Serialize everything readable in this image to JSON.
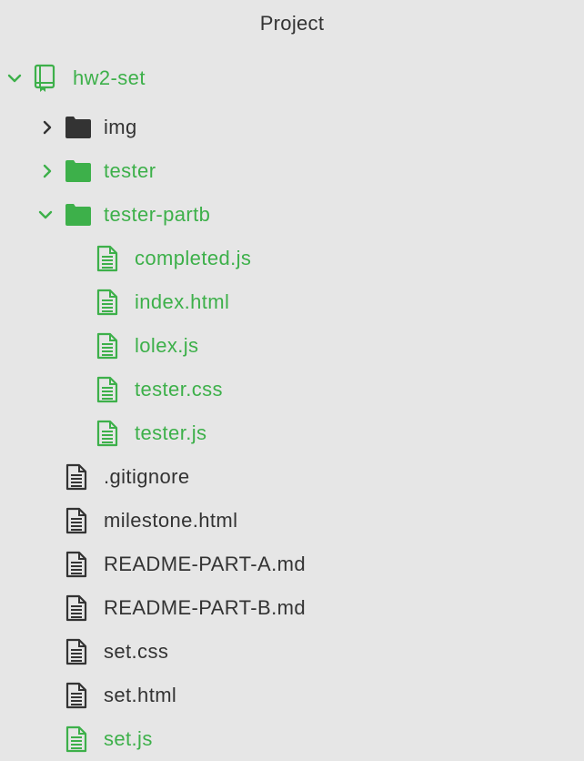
{
  "panel": {
    "title": "Project"
  },
  "colors": {
    "vcs_modified": "#3db04a",
    "default_text": "#333333",
    "background": "#e6e6e6"
  },
  "tree": {
    "root": {
      "label": "hw2-set",
      "icon": "repo-book-icon",
      "expanded": true,
      "status": "modified"
    },
    "items": [
      {
        "label": "img",
        "type": "folder",
        "expanded": false,
        "status": "normal"
      },
      {
        "label": "tester",
        "type": "folder",
        "expanded": false,
        "status": "modified"
      },
      {
        "label": "tester-partb",
        "type": "folder",
        "expanded": true,
        "status": "modified"
      },
      {
        "label": "completed.js",
        "type": "file",
        "status": "modified"
      },
      {
        "label": "index.html",
        "type": "file",
        "status": "modified"
      },
      {
        "label": "lolex.js",
        "type": "file",
        "status": "modified"
      },
      {
        "label": "tester.css",
        "type": "file",
        "status": "modified"
      },
      {
        "label": "tester.js",
        "type": "file",
        "status": "modified"
      },
      {
        "label": ".gitignore",
        "type": "file",
        "status": "normal"
      },
      {
        "label": "milestone.html",
        "type": "file",
        "status": "normal"
      },
      {
        "label": "README-PART-A.md",
        "type": "file",
        "status": "normal"
      },
      {
        "label": "README-PART-B.md",
        "type": "file",
        "status": "normal"
      },
      {
        "label": "set.css",
        "type": "file",
        "status": "normal"
      },
      {
        "label": "set.html",
        "type": "file",
        "status": "normal"
      },
      {
        "label": "set.js",
        "type": "file",
        "status": "modified"
      }
    ]
  }
}
